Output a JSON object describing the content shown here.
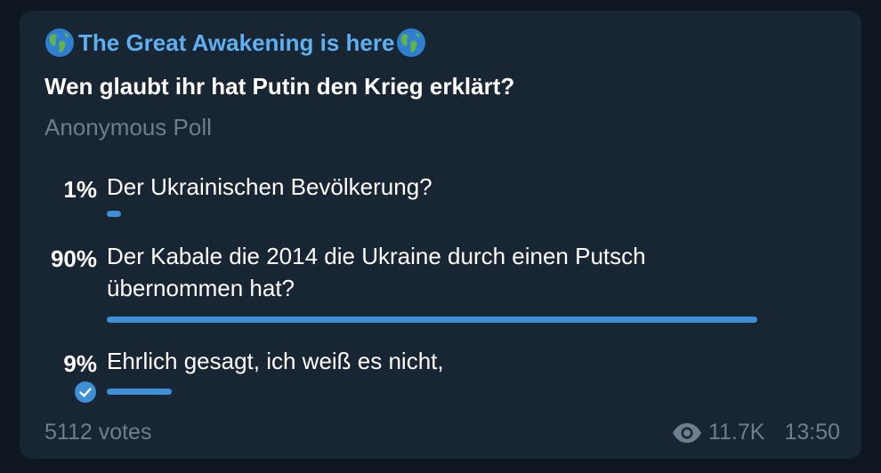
{
  "post": {
    "channel_name": "The Great Awakening is here",
    "channel_emoji": "earth-globe-americas-icon",
    "question": "Wen glaubt ihr hat Putin den Krieg erklärt?",
    "poll_type": "Anonymous Poll",
    "options": [
      {
        "percent_label": "1%",
        "text": "Der Ukrainischen Bevölkerung?",
        "fraction": 0.01,
        "chosen": false
      },
      {
        "percent_label": "90%",
        "text": "Der Kabale die 2014 die Ukraine durch einen Putsch übernommen hat?",
        "fraction": 0.9,
        "chosen": false
      },
      {
        "percent_label": "9%",
        "text": "Ehrlich gesagt, ich weiß es nicht,",
        "fraction": 0.09,
        "chosen": true
      }
    ],
    "votes": "5112 votes",
    "views": "11.7K",
    "time": "13:50"
  },
  "colors": {
    "background": "#0e1621",
    "card": "#182533",
    "accent": "#5fb0f0",
    "bar": "#3d8fd6",
    "muted": "#6d7f8f"
  }
}
